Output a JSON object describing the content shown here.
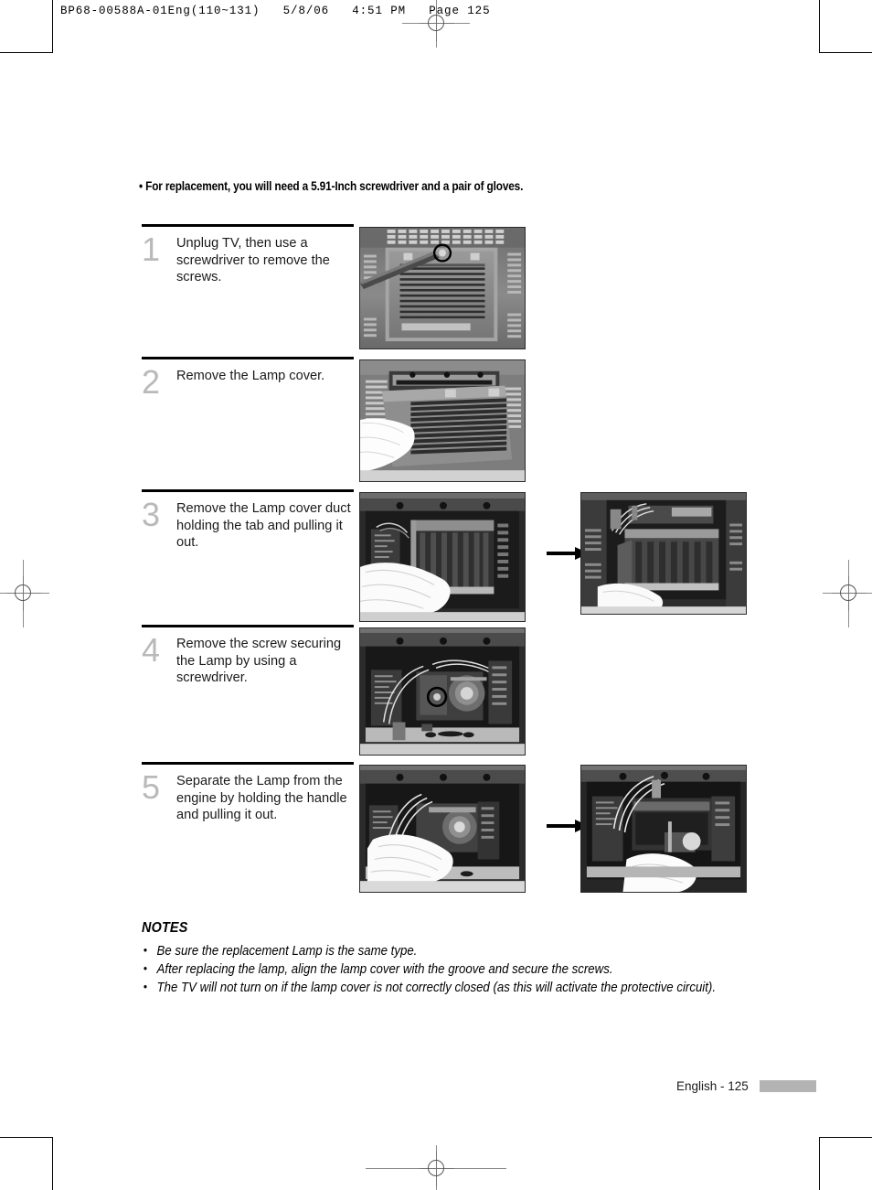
{
  "page": {
    "header_slug": "BP68-00588A-01Eng(110~131)   5/8/06   4:51 PM   Page 125",
    "intro_note": "• For replacement, you will need a 5.91-Inch screwdriver and a pair of gloves.",
    "footer_text": "English - 125",
    "footer_bar_color": "#b3b3b3",
    "step_number_color": "#b9b9b9"
  },
  "steps": [
    {
      "number": "1",
      "text": "Unplug TV, then use a screwdriver to remove the screws.",
      "photos": [
        {
          "caption": "lamp-cover-vent-with-screwdriver",
          "highlight": "circled-screw"
        }
      ],
      "arrow": false
    },
    {
      "number": "2",
      "text": "Remove the Lamp cover.",
      "photos": [
        {
          "caption": "gloved-hand-removing-lamp-cover",
          "highlight": "none"
        }
      ],
      "arrow": false
    },
    {
      "number": "3",
      "text": "Remove the Lamp cover duct holding the tab and pulling it out.",
      "photos": [
        {
          "caption": "lamp-cover-duct-in-place",
          "highlight": "none"
        },
        {
          "caption": "lamp-cover-duct-removed",
          "highlight": "none"
        }
      ],
      "arrow": true
    },
    {
      "number": "4",
      "text": "Remove the screw securing the Lamp by using a screwdriver.",
      "photos": [
        {
          "caption": "lamp-engine-securing-screw",
          "highlight": "circled-screw"
        }
      ],
      "arrow": false
    },
    {
      "number": "5",
      "text": "Separate the Lamp from the engine by holding the handle and pulling it out.",
      "photos": [
        {
          "caption": "gripping-lamp-handle",
          "highlight": "none"
        },
        {
          "caption": "lamp-pulled-out-of-engine",
          "highlight": "none"
        }
      ],
      "arrow": true
    }
  ],
  "notes": {
    "title": "NOTES",
    "items": [
      "Be sure the replacement Lamp is the same type.",
      "After replacing the lamp, align the lamp cover with the groove and secure the screws.",
      "The TV will not turn on if the lamp cover is not correctly closed (as this will activate the protective circuit)."
    ]
  }
}
